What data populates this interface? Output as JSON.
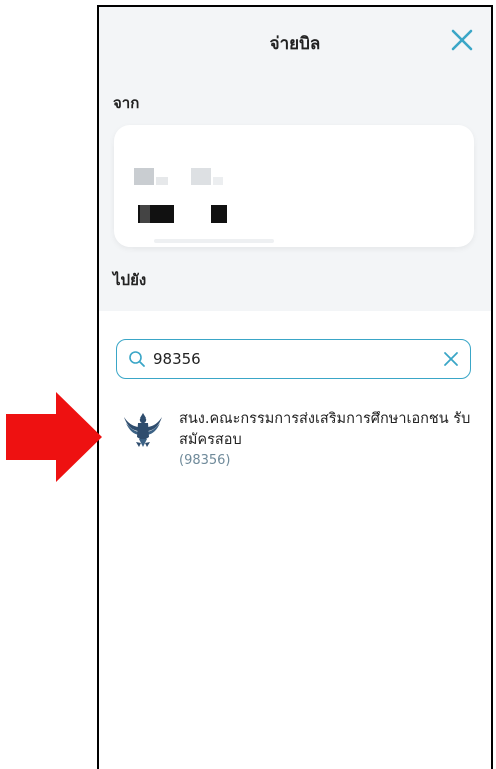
{
  "header": {
    "title": "จ่ายบิล"
  },
  "from_section": {
    "label": "จาก"
  },
  "to_section": {
    "label": "ไปยัง"
  },
  "search": {
    "value": "98356",
    "placeholder": ""
  },
  "results": [
    {
      "name": "สนง.คณะกรรมการส่งเสริมการศึกษาเอกชน รับสมัครสอบ",
      "code": "(98356)"
    }
  ],
  "colors": {
    "accent": "#3aa6c7",
    "arrow": "#ee1111",
    "logo": "#2f4d6e"
  },
  "icons": {
    "close": "close-icon",
    "search": "search-icon",
    "clear": "clear-icon",
    "logo": "garuda-emblem",
    "pointer": "red-arrow"
  }
}
